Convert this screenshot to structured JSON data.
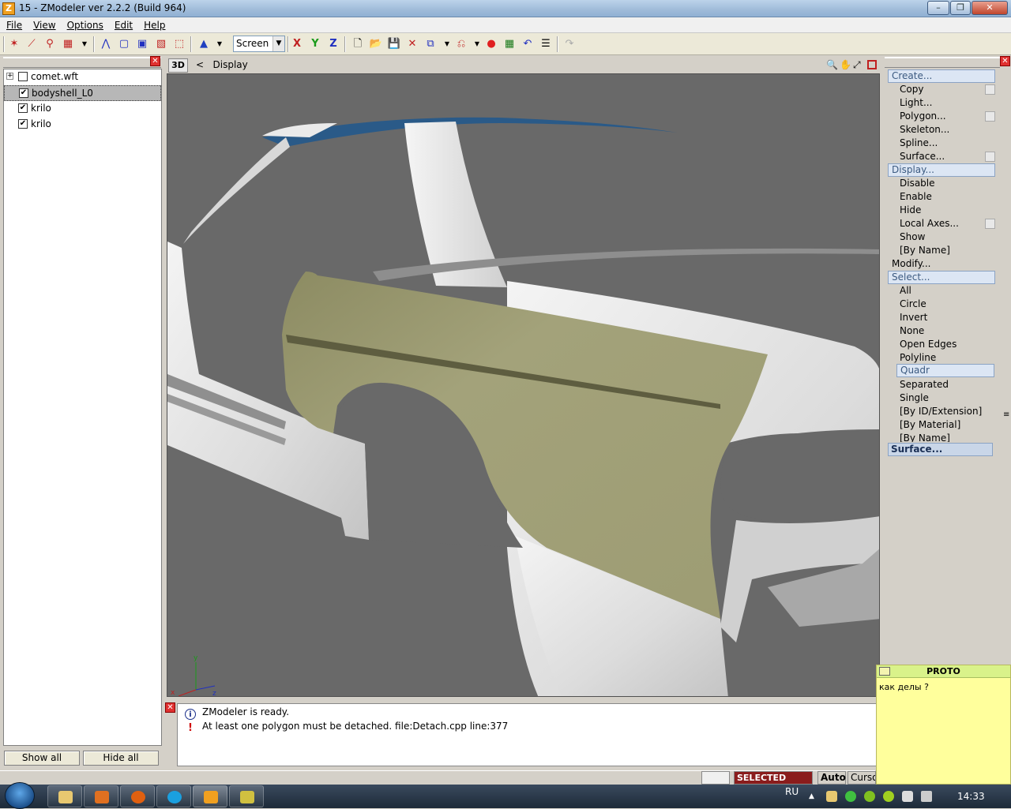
{
  "window": {
    "title": "15 - ZModeler ver 2.2.2 (Build 964)",
    "icon_letter": "Z"
  },
  "menu": [
    "File",
    "View",
    "Options",
    "Edit",
    "Help"
  ],
  "toolbar": {
    "space_select": "Screen",
    "axis_x": "X",
    "axis_y": "Y",
    "axis_z": "Z"
  },
  "tree": {
    "items": [
      {
        "label": "comet.wft",
        "checked": false,
        "expandable": true
      },
      {
        "label": "bodyshell_L0",
        "checked": true,
        "selected": true
      },
      {
        "label": "krilo",
        "checked": true
      },
      {
        "label": "krilo",
        "checked": true
      }
    ],
    "show_all": "Show all",
    "hide_all": "Hide all"
  },
  "viewport": {
    "mode": "3D",
    "back": "<",
    "title": "Display",
    "gizmo": {
      "x": "x",
      "y": "y",
      "z": "z"
    }
  },
  "commands": {
    "create": {
      "label": "Create...",
      "items": [
        "Copy",
        "Light...",
        "Polygon...",
        "Skeleton...",
        "Spline...",
        "Surface..."
      ]
    },
    "display": {
      "label": "Display...",
      "items": [
        "Disable",
        "Enable",
        "Hide",
        "Local Axes...",
        "Show",
        "[By Name]"
      ]
    },
    "modify": {
      "label": "Modify..."
    },
    "select": {
      "label": "Select...",
      "items": [
        "All",
        "Circle",
        "Invert",
        "None",
        "Open Edges",
        "Polyline",
        "Quadr",
        "Separated",
        "Single",
        "[By ID/Extension]",
        "[By Material]",
        "[By Name]"
      ],
      "active": "Quadr"
    },
    "surface": {
      "label": "Surface..."
    }
  },
  "log": [
    {
      "type": "info",
      "icon": "i",
      "text": "ZModeler is ready."
    },
    {
      "type": "error",
      "icon": "!",
      "text": "At least one polygon must be detached. file:Detach.cpp line:377"
    }
  ],
  "statusbar": {
    "mode": "SELECTED MODE",
    "snap": "Auto",
    "cursor": "Cursor"
  },
  "note": {
    "title": "PROTO",
    "body": "как делы ?"
  },
  "taskbar": {
    "lang": "RU",
    "time": "14:33"
  },
  "colors": {
    "selected_panel": "#a3a27a",
    "body_white": "#e6e6e6",
    "roof_blue": "#2a5a88",
    "viewport_bg": "#696969",
    "status_mode": "#8a1c1c"
  }
}
